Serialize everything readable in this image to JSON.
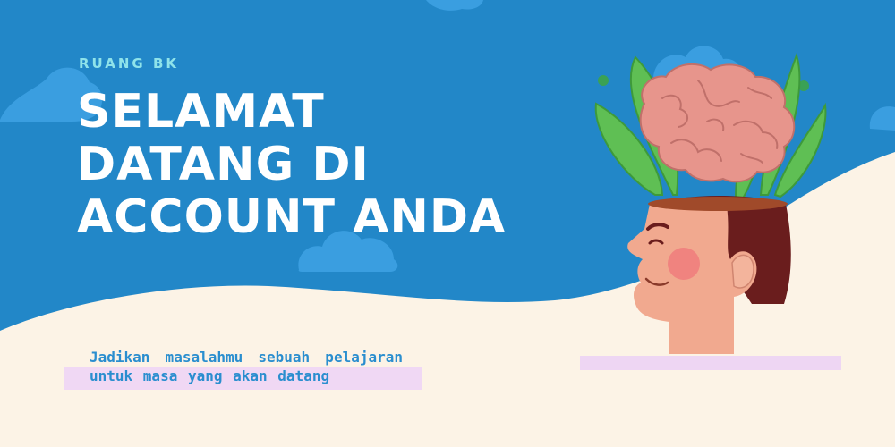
{
  "header": {
    "eyebrow": "RUANG BK",
    "title_lines": [
      "SELAMAT",
      "DATANG DI",
      "ACCOUNT ANDA"
    ]
  },
  "quote": {
    "text": "Jadikan masalahmu sebuah pelajaran untuk masa yang akan datang"
  },
  "illustration": {
    "name": "head-with-brain-and-plants-illustration"
  },
  "colors": {
    "background_blue": "#2287c8",
    "cream": "#fcf3e6",
    "cloud": "#3a9ee0",
    "title": "#ffffff",
    "eyebrow": "#8fe3ea",
    "quote_text": "#2a8ecf",
    "highlight": "#f0d8f4",
    "brain": "#e7958c",
    "leaf": "#5fbf54",
    "skin": "#f1a98f",
    "hair": "#6a1d1d"
  }
}
